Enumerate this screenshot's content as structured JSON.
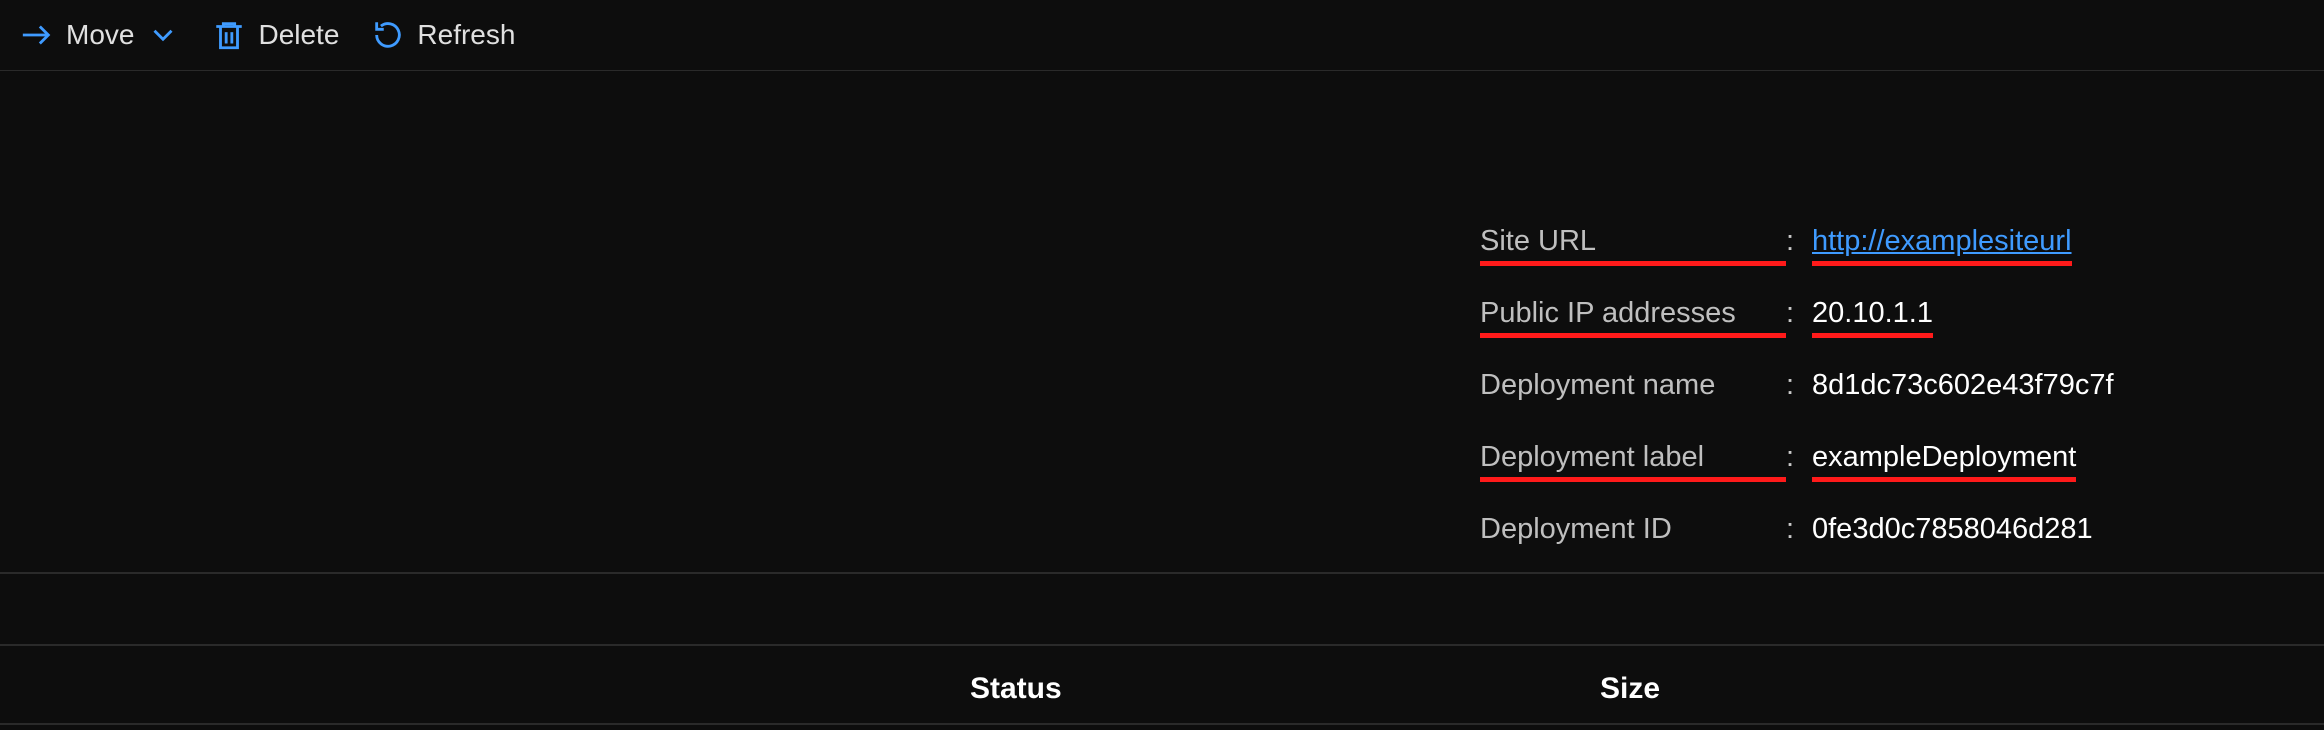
{
  "toolbar": {
    "move_label": "Move",
    "delete_label": "Delete",
    "refresh_label": "Refresh"
  },
  "details": {
    "site_url_label": "Site URL",
    "site_url_value": "http://examplesiteurl",
    "public_ip_label": "Public IP addresses",
    "public_ip_value": "20.10.1.1",
    "deployment_name_label": "Deployment name",
    "deployment_name_value": "8d1dc73c602e43f79c7f",
    "deployment_label_label": "Deployment label",
    "deployment_label_value": "exampleDeployment",
    "deployment_id_label": "Deployment ID",
    "deployment_id_value": "0fe3d0c7858046d281"
  },
  "table": {
    "col_status": "Status",
    "col_size": "Size"
  }
}
